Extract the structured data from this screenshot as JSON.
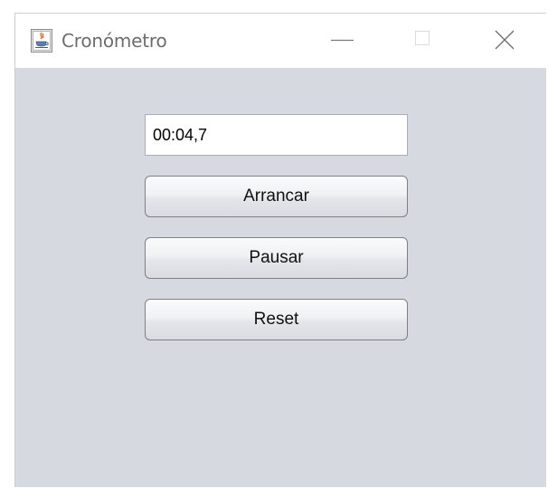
{
  "window": {
    "title": "Cronómetro",
    "icon": "java-cup-icon",
    "controls": {
      "minimize": "minimize-icon",
      "maximize": "maximize-icon",
      "close": "close-icon"
    }
  },
  "main": {
    "time_display": "00:04,7",
    "buttons": {
      "start_label": "Arrancar",
      "pause_label": "Pausar",
      "reset_label": "Reset"
    }
  },
  "colors": {
    "window_background": "#d6d9df",
    "titlebar_background": "#ffffff",
    "button_border": "#7c7f86"
  }
}
